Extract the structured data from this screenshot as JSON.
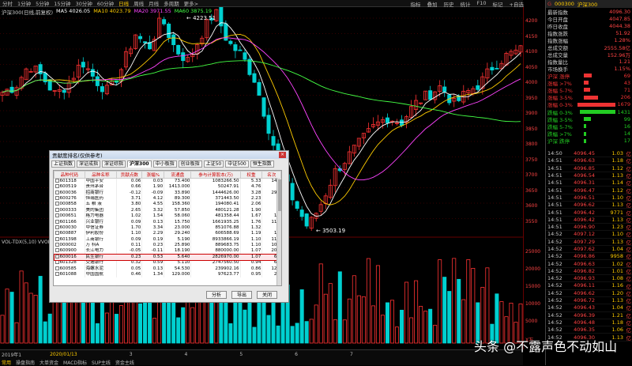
{
  "toolbar": {
    "items": [
      "分时",
      "1分钟",
      "5分钟",
      "15分钟",
      "30分钟",
      "60分钟",
      "日线",
      "周线",
      "月线",
      "多周期",
      "更多>"
    ],
    "active_index": 6,
    "right": [
      "指标",
      "叠加",
      "历史",
      "统计",
      "F10",
      "标记",
      "+自选"
    ]
  },
  "ma_legend": {
    "title": "沪深300(日线,前复权)",
    "items": [
      {
        "text": "MA5 4026.05",
        "color": "#ffffff"
      },
      {
        "text": "MA10 4023.79",
        "color": "#ffcc00"
      },
      {
        "text": "MA20 3971.55",
        "color": "#ff44ff"
      },
      {
        "text": "MA60 3875.19",
        "color": "#44ff44"
      }
    ]
  },
  "chart_labels": {
    "high": "4223.51",
    "low": "3503.19",
    "price_flag": "3955.8"
  },
  "volume_legend": "VOL-TDX(5,10) VVOL:",
  "price_axis": [
    "4200",
    "4150",
    "4100",
    "4050",
    "4000",
    "3950",
    "3900",
    "3850",
    "3800",
    "3750",
    "3700",
    "3650",
    "3600",
    "3550"
  ],
  "volume_axis": [
    "25000",
    "20000",
    "15000",
    "10000",
    "5000",
    "X万"
  ],
  "bottom_bar": {
    "row1": [
      "2019年1",
      "2020/01/13",
      "3",
      "4",
      "5",
      "6",
      "7"
    ],
    "row2": [
      "指标",
      "模板",
      "量能",
      "MACD",
      "KDJ",
      "RSI",
      "BOLL",
      "DMI",
      "WR",
      "CCI",
      "BIAS",
      "OBV"
    ],
    "row3_items": [
      "常用",
      "操盘指南",
      "大单资金",
      "MACD指标",
      "SUP主线",
      "资金主线"
    ]
  },
  "dialog": {
    "title": "贡献度排名(仅供参考)",
    "tabs": [
      "上证指数",
      "深证成指",
      "深证综指",
      "沪深300",
      "中小板指",
      "创业板指",
      "上证50",
      "中证500",
      "恒生指数"
    ],
    "selected_tab": 3,
    "columns": [
      "品种代码",
      "品种名称",
      "贡献点数",
      "涨幅%",
      "流通盘",
      "参与计算股本(万)",
      "权重",
      "名次"
    ],
    "rows": [
      [
        "601318",
        "中国平安",
        "0.06",
        "0.03",
        "73.400",
        "1083266.50",
        "5.33",
        "145"
      ],
      [
        "600519",
        "贵州茅台",
        "0.66",
        "1.90",
        "1413.000",
        "50247.91",
        "4.76",
        "3"
      ],
      [
        "600036",
        "招商银行",
        "-0.12",
        "-0.09",
        "33.890",
        "1444626.00",
        "3.28",
        "295"
      ],
      [
        "600276",
        "恒瑞医药",
        "3.71",
        "4.12",
        "89.300",
        "371443.50",
        "2.23",
        "2"
      ],
      [
        "000858",
        "五 粮 液",
        "3.80",
        "4.55",
        "158.360",
        "194080.41",
        "2.06",
        "1"
      ],
      [
        "000333",
        "美的集团",
        "2.65",
        "3.32",
        "57.850",
        "480121.28",
        "1.90",
        "4"
      ],
      [
        "000651",
        "格力电器",
        "1.02",
        "1.54",
        "58.060",
        "481358.44",
        "1.67",
        "11"
      ],
      [
        "601166",
        "兴业银行",
        "0.09",
        "0.13",
        "15.750",
        "1661935.25",
        "1.76",
        "114"
      ],
      [
        "600030",
        "中信证券",
        "1.70",
        "3.34",
        "23.000",
        "851076.88",
        "1.32",
        "6"
      ],
      [
        "600887",
        "伊利股份",
        "1.10",
        "2.29",
        "29.240",
        "606588.69",
        "1.19",
        "10"
      ],
      [
        "601398",
        "工商银行",
        "0.09",
        "0.19",
        "5.190",
        "8933866.19",
        "1.10",
        "112"
      ],
      [
        "000002",
        "万 科A",
        "0.11",
        "0.23",
        "25.890",
        "889683.75",
        "1.10",
        "100"
      ],
      [
        "600900",
        "长江电力",
        "-0.05",
        "-0.11",
        "18.190",
        "880000.00",
        "1.07",
        "201"
      ],
      [
        "600016",
        "民生银行",
        "0.23",
        "0.53",
        "5.640",
        "2826970.00",
        "1.07",
        "65"
      ],
      [
        "601328",
        "交通银行",
        "0.32",
        "0.59",
        "5.110",
        "2747560.50",
        "0.94",
        "60"
      ],
      [
        "600585",
        "海螺水泥",
        "0.05",
        "0.13",
        "54.530",
        "239902.16",
        "0.86",
        "127"
      ],
      [
        "601088",
        "中国国航",
        "0.46",
        "1.34",
        "129.000",
        "97623.77",
        "0.95",
        "27"
      ]
    ],
    "extra_row": [
      "600276",
      "立讯精密",
      "1.6",
      "3.14",
      "45.450",
      "419032.28",
      "1.28",
      "215"
    ],
    "selected_row": 13,
    "buttons": [
      "分析",
      "导出",
      "关闭"
    ]
  },
  "panel": {
    "code": "000300",
    "name": "沪深300",
    "stats": [
      [
        "最新指数",
        "4096.30"
      ],
      [
        "今日开盘",
        "4047.85"
      ],
      [
        "昨日收盘",
        "4044.38"
      ],
      [
        "指数涨跌",
        "51.92"
      ],
      [
        "指数涨幅",
        "1.28%"
      ],
      [
        "总成交额",
        "2555.58亿"
      ],
      [
        "总成交量",
        "152.96万"
      ],
      [
        "指数量比",
        "1.21"
      ],
      [
        "市场换手",
        "1.15%"
      ]
    ],
    "breadth": [
      {
        "label": "沪深 涨停",
        "count": "69",
        "w": 10,
        "c": "#e33"
      },
      {
        "label": "涨幅 >7%",
        "count": "43",
        "w": 6,
        "c": "#e33"
      },
      {
        "label": "涨幅 5-7%",
        "count": "71",
        "w": 8,
        "c": "#e33"
      },
      {
        "label": "涨幅 3-5%",
        "count": "206",
        "w": 18,
        "c": "#e33"
      },
      {
        "label": "涨幅 0-3%",
        "count": "1679",
        "w": 60,
        "c": "#e33"
      },
      {
        "label": "跌幅 0-3%",
        "count": "1431",
        "w": 52,
        "c": "#2c2"
      },
      {
        "label": "跌幅 3-5%",
        "count": "99",
        "w": 9,
        "c": "#2c2"
      },
      {
        "label": "跌幅 5-7%",
        "count": "16",
        "w": 3,
        "c": "#2c2"
      },
      {
        "label": "跌幅 >7%",
        "count": "14",
        "w": 3,
        "c": "#2c2"
      },
      {
        "label": "沪深 跌停",
        "count": "17",
        "w": 3,
        "c": "#2c2"
      }
    ],
    "ticks": [
      [
        "14:50",
        "4096.45",
        "1.03"
      ],
      [
        "14:51",
        "4096.63",
        "1.18"
      ],
      [
        "14:51",
        "4096.85",
        "1.12"
      ],
      [
        "14:51",
        "4096.54",
        "1.13"
      ],
      [
        "14:51",
        "4096.31",
        "1.14"
      ],
      [
        "14:51",
        "4096.47",
        "1.12"
      ],
      [
        "14:51",
        "4096.51",
        "1.10"
      ],
      [
        "14:51",
        "4096.62",
        "1.13"
      ],
      [
        "14:51",
        "4096.42",
        "9771"
      ],
      [
        "14:51",
        "4096.42",
        "1.13"
      ],
      [
        "14:51",
        "4096.90",
        "1.23"
      ],
      [
        "14:52",
        "4097.12",
        "1.10"
      ],
      [
        "14:52",
        "4097.29",
        "1.13"
      ],
      [
        "14:52",
        "4097.62",
        "1.04"
      ],
      [
        "14:52",
        "4096.86",
        "9958"
      ],
      [
        "14:52",
        "4096.63",
        "1.02"
      ],
      [
        "14:52",
        "4096.82",
        "1.01"
      ],
      [
        "14:52",
        "4096.93",
        "1.08"
      ],
      [
        "14:52",
        "4096.11",
        "1.16"
      ],
      [
        "14:52",
        "4096.62",
        "1.20"
      ],
      [
        "14:52",
        "4096.72",
        "1.13"
      ],
      [
        "14:52",
        "4096.43",
        "1.04"
      ],
      [
        "14:52",
        "4096.39",
        "1.21"
      ],
      [
        "14:52",
        "4096.48",
        "1.18"
      ],
      [
        "14:52",
        "4096.35",
        "1.06"
      ],
      [
        "14:52",
        "4096.30",
        "1.13"
      ]
    ]
  },
  "watermark": "头条 @不露声色不动如山",
  "colors": {
    "up": "#ff3333",
    "down": "#00d0d0",
    "ma5": "#ffffff",
    "ma10": "#ffcc00",
    "ma20": "#ff44ff",
    "ma60": "#44ff44"
  }
}
